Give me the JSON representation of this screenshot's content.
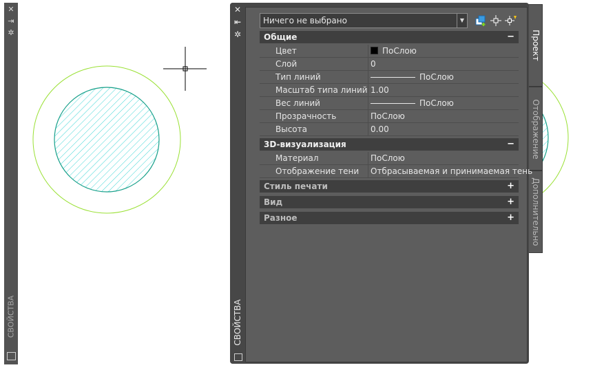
{
  "left_panel": {
    "title": "СВОЙСТВА",
    "controls": [
      "close-icon",
      "autohide-icon",
      "properties-icon"
    ]
  },
  "palette": {
    "title": "СВОЙСТВА",
    "controls": [
      "close-icon",
      "autohide-icon",
      "properties-icon"
    ]
  },
  "toolbar": {
    "selection": "Ничего не выбрано",
    "icons": [
      "toggle-pickadd-icon",
      "select-objects-icon",
      "quick-select-icon"
    ]
  },
  "sections": {
    "general": {
      "title": "Общие",
      "toggle": "−",
      "rows": [
        {
          "label": "Цвет",
          "value": "ПоСлою"
        },
        {
          "label": "Слой",
          "value": "0"
        },
        {
          "label": "Тип линий",
          "value": "ПоСлою"
        },
        {
          "label": "Масштаб типа линий",
          "value": "1.00"
        },
        {
          "label": "Вес линий",
          "value": "ПоСлою"
        },
        {
          "label": "Прозрачность",
          "value": "ПоСлою"
        },
        {
          "label": "Высота",
          "value": "0.00"
        }
      ]
    },
    "viz3d": {
      "title": "3D-визуализация",
      "toggle": "−",
      "rows": [
        {
          "label": "Материал",
          "value": "ПоСлою"
        },
        {
          "label": "Отображение тени",
          "value": "Отбрасываемая и принимаемая тень"
        }
      ]
    },
    "plotstyle": {
      "title": "Стиль печати",
      "toggle": "+"
    },
    "view": {
      "title": "Вид",
      "toggle": "+"
    },
    "misc": {
      "title": "Разное",
      "toggle": "+"
    }
  },
  "tabs": [
    {
      "label": "Проект",
      "active": true
    },
    {
      "label": "Отображение",
      "active": false
    },
    {
      "label": "Дополнительно",
      "active": false
    }
  ],
  "colors": {
    "outer_circle": "#99e033",
    "inner_circle": "#17a08a",
    "hatch": "#3fd6d6",
    "panel_bg": "#5d5d5d",
    "section_header": "#3f3f3f"
  }
}
